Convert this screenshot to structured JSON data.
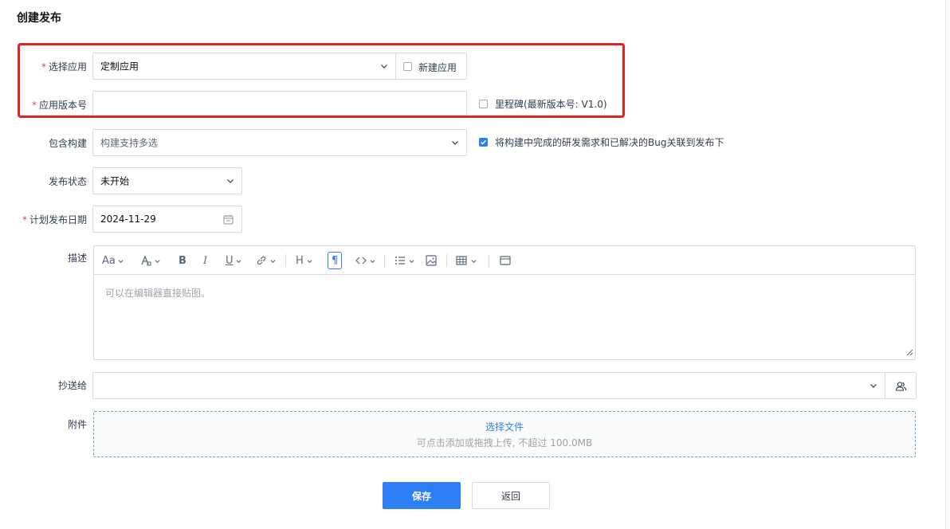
{
  "page": {
    "title": "创建发布"
  },
  "form": {
    "app": {
      "label": "选择应用",
      "required": true,
      "value": "定制应用",
      "new_app_label": "新建应用"
    },
    "version": {
      "label": "应用版本号",
      "required": true,
      "value": "",
      "milestone_label": "里程碑(最新版本号: V1.0)"
    },
    "builds": {
      "label": "包含构建",
      "placeholder": "构建支持多选",
      "link_label": "将构建中完成的研发需求和已解决的Bug关联到发布下",
      "link_checked": true
    },
    "status": {
      "label": "发布状态",
      "value": "未开始"
    },
    "date": {
      "label": "计划发布日期",
      "required": true,
      "value": "2024-11-29"
    },
    "description": {
      "label": "描述",
      "placeholder": "可以在编辑器直接贴图。"
    },
    "cc": {
      "label": "抄送给",
      "value": ""
    },
    "attachments": {
      "label": "附件",
      "select_label": "选择文件",
      "hint": "可点击添加或拖拽上传, 不超过 100.0MB"
    }
  },
  "editor_toolbar": {
    "items": [
      "font-size-icon",
      "text-color-icon",
      "bold-icon",
      "italic-icon",
      "underline-icon",
      "link-icon",
      "heading-icon",
      "paragraph-icon",
      "code-icon",
      "list-icon",
      "image-icon",
      "table-icon",
      "fullscreen-icon"
    ],
    "bold": "B",
    "italic": "I",
    "underline": "U",
    "heading": "H",
    "paragraph": "¶",
    "font_size": "Aa"
  },
  "actions": {
    "save_label": "保存",
    "back_label": "返回"
  },
  "colors": {
    "primary": "#2e7ff6",
    "required": "#e5484d",
    "highlight": "#e3231e"
  }
}
